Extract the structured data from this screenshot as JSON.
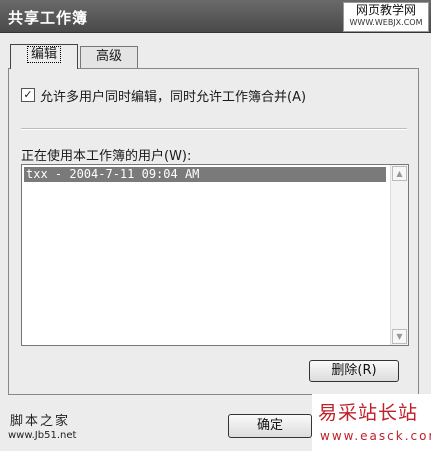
{
  "window": {
    "title": "共享工作簿"
  },
  "watermarks": {
    "top_right_line1": "网页教学网",
    "top_right_line2": "WWW.WEBJX.COM",
    "bottom_left_line1": "脚本之家",
    "bottom_left_line2": "www.Jb51.net",
    "bottom_right_line1": "易采站长站",
    "bottom_right_line2": "www.easck.com"
  },
  "tabs": [
    {
      "label": "编辑",
      "active": true
    },
    {
      "label": "高级",
      "active": false
    }
  ],
  "edit_tab": {
    "allow_changes": {
      "label": "允许多用户同时编辑，同时允许工作簿合并(A)",
      "checked": true,
      "check_glyph": "✓"
    },
    "users_label": "正在使用本工作簿的用户(W):",
    "users": [
      "txx - 2004-7-11 09:04 AM"
    ],
    "delete_button": "删除(R)"
  },
  "footer": {
    "ok_button": "确定"
  },
  "colors": {
    "titlebar": "#4f4f4f",
    "selection": "#7a7a7a",
    "watermark_red": "#c0202a"
  }
}
